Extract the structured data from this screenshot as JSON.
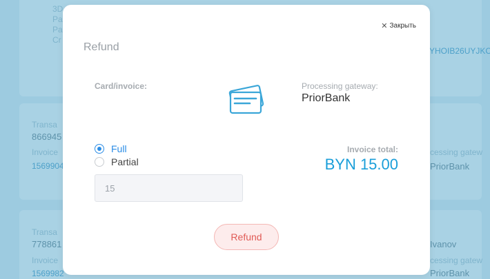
{
  "background": {
    "top_left_lines": [
      "3D",
      "Pa",
      "Pa",
      "Cr"
    ],
    "top_right_link": "YHOIB26UYJKC",
    "card2": {
      "label_left": "Transa",
      "id": "866945",
      "sub_label": "Invoice",
      "sub_value": "1569904",
      "right_label": "cessing gatew",
      "right_value": "PriorBank"
    },
    "card3": {
      "label_left": "Transa",
      "id": "778861",
      "sub_label": "Invoice",
      "sub_value": "1569982",
      "right_name": "Ivanov",
      "right_label": "cessing gatew",
      "right_value": "PriorBank"
    }
  },
  "modal": {
    "close_label": "Закрыть",
    "title": "Refund",
    "card_label": "Card/invoice:",
    "gateway_label": "Processing gateway:",
    "gateway_value": "PriorBank",
    "radio_full": "Full",
    "radio_partial": "Partial",
    "selected": "Full",
    "amount_value": "15",
    "total_label": "Invoice total:",
    "total_value": "BYN 15.00",
    "refund_button": "Refund"
  },
  "colors": {
    "accent": "#2b8de6",
    "total": "#1a9ed9",
    "refund_button_bg": "#fdecec",
    "refund_button_text": "#e05a55",
    "icon": "#3aa6d8"
  },
  "icons": {
    "close": "close-icon",
    "card": "credit-cards-icon"
  }
}
